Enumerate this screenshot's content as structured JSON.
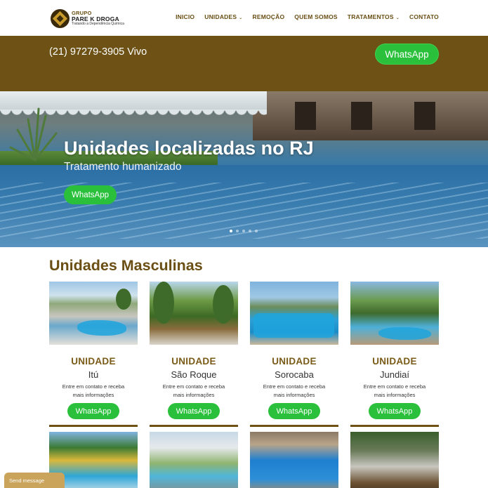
{
  "header": {
    "logo": {
      "line1": "GRUPO",
      "line2": "PARE K DROGA",
      "line3": "Tratando a Dependência Química"
    },
    "nav": [
      {
        "label": "INICIO",
        "dropdown": false
      },
      {
        "label": "UNIDADES",
        "dropdown": true
      },
      {
        "label": "REMOÇÃO",
        "dropdown": false
      },
      {
        "label": "QUEM SOMOS",
        "dropdown": false
      },
      {
        "label": "TRATAMENTOS",
        "dropdown": true
      },
      {
        "label": "CONTATO",
        "dropdown": false
      }
    ]
  },
  "topbar": {
    "phone": "(21) 97279-3905 Vivo",
    "whatsapp_label": "WhatsApp"
  },
  "hero": {
    "title": "Unidades localizadas no RJ",
    "subtitle": "Tratamento humanizado",
    "whatsapp_label": "WhatsApp",
    "slide_count": 5,
    "active_slide": 1
  },
  "section": {
    "title": "Unidades Masculinas"
  },
  "cards": [
    {
      "label": "UNIDADE",
      "city": "Itú",
      "desc": "Entre em contato e receba mais informações",
      "button": "WhatsApp"
    },
    {
      "label": "UNIDADE",
      "city": "São Roque",
      "desc": "Entre em contato e receba mais informações",
      "button": "WhatsApp"
    },
    {
      "label": "UNIDADE",
      "city": "Sorocaba",
      "desc": "Entre em contato e receba mais informações",
      "button": "WhatsApp"
    },
    {
      "label": "UNIDADE",
      "city": "Jundiaí",
      "desc": "Entre em contato e receba mais informações",
      "button": "WhatsApp"
    }
  ],
  "chat": {
    "label": "Send message"
  },
  "colors": {
    "brand_brown": "#6d5115",
    "heading_brown": "#6a4e13",
    "whatsapp_green": "#2bc03c"
  }
}
